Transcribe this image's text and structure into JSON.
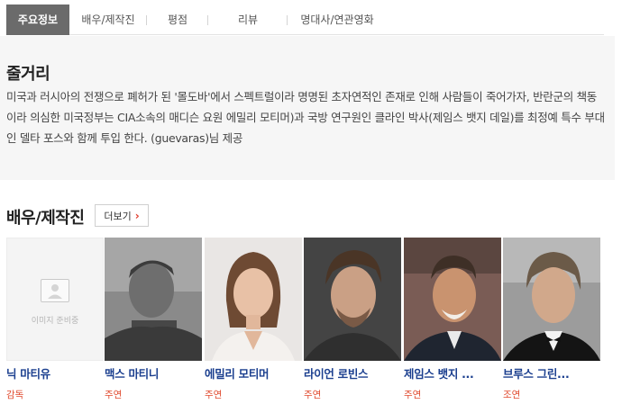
{
  "tabs": [
    {
      "label": "주요정보",
      "active": true
    },
    {
      "label": "배우/제작진"
    },
    {
      "label": "평점"
    },
    {
      "label": "리뷰"
    },
    {
      "label": "명대사/연관영화"
    }
  ],
  "synopsis": {
    "title": "줄거리",
    "text": "미국과 러시아의 전쟁으로 폐허가 된 '몰도바'에서 스펙트럴이라 명명된 초자연적인 존재로 인해 사람들이 죽어가자, 반란군의 책동이라 의심한 미국정부는 CIA소속의 매디슨 요원 에밀리 모티머)과 국방 연구원인 클라인 박사(제임스 뱃지 데일)를 최정예 특수 부대인 델타 포스와 함께 투입 한다. (guevaras)님 제공"
  },
  "cast_section": {
    "title": "배우/제작진",
    "more_label": "더보기",
    "more_arrow": "›",
    "placeholder_text": "이미지 준비중"
  },
  "cast": [
    {
      "name": "닉 마티유",
      "role": "감독"
    },
    {
      "name": "맥스 마티니",
      "role": "주연"
    },
    {
      "name": "에밀리 모티머",
      "role": "주연"
    },
    {
      "name": "라이언 로빈스",
      "role": "주연"
    },
    {
      "name": "제임스 뱃지 ...",
      "role": "주연"
    },
    {
      "name": "브루스 그린...",
      "role": "조연"
    }
  ],
  "colors": {
    "active_tab": "#6b6b6b",
    "name_link": "#1b3f8f",
    "role_text": "#e04a2e"
  }
}
